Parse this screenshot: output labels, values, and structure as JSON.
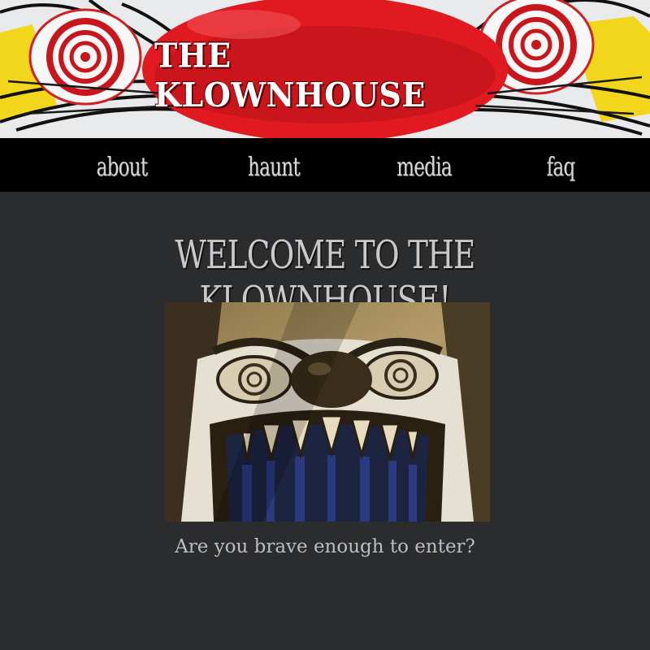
{
  "header": {
    "title": "THE KLOWNHOUSE"
  },
  "nav": {
    "items": [
      {
        "label": "about"
      },
      {
        "label": "haunt"
      },
      {
        "label": "media"
      },
      {
        "label": "faq"
      }
    ]
  },
  "main": {
    "welcome": "WELCOME TO THE KLOWNHOUSE!",
    "tagline": "Are you brave enough to enter?",
    "hero_image": "clown-face-mouth-entrance-photo"
  },
  "colors": {
    "background": "#2b2c2e",
    "nav_background": "#000000",
    "brand_red": "#d0161c",
    "text": "#c9c9c9"
  }
}
